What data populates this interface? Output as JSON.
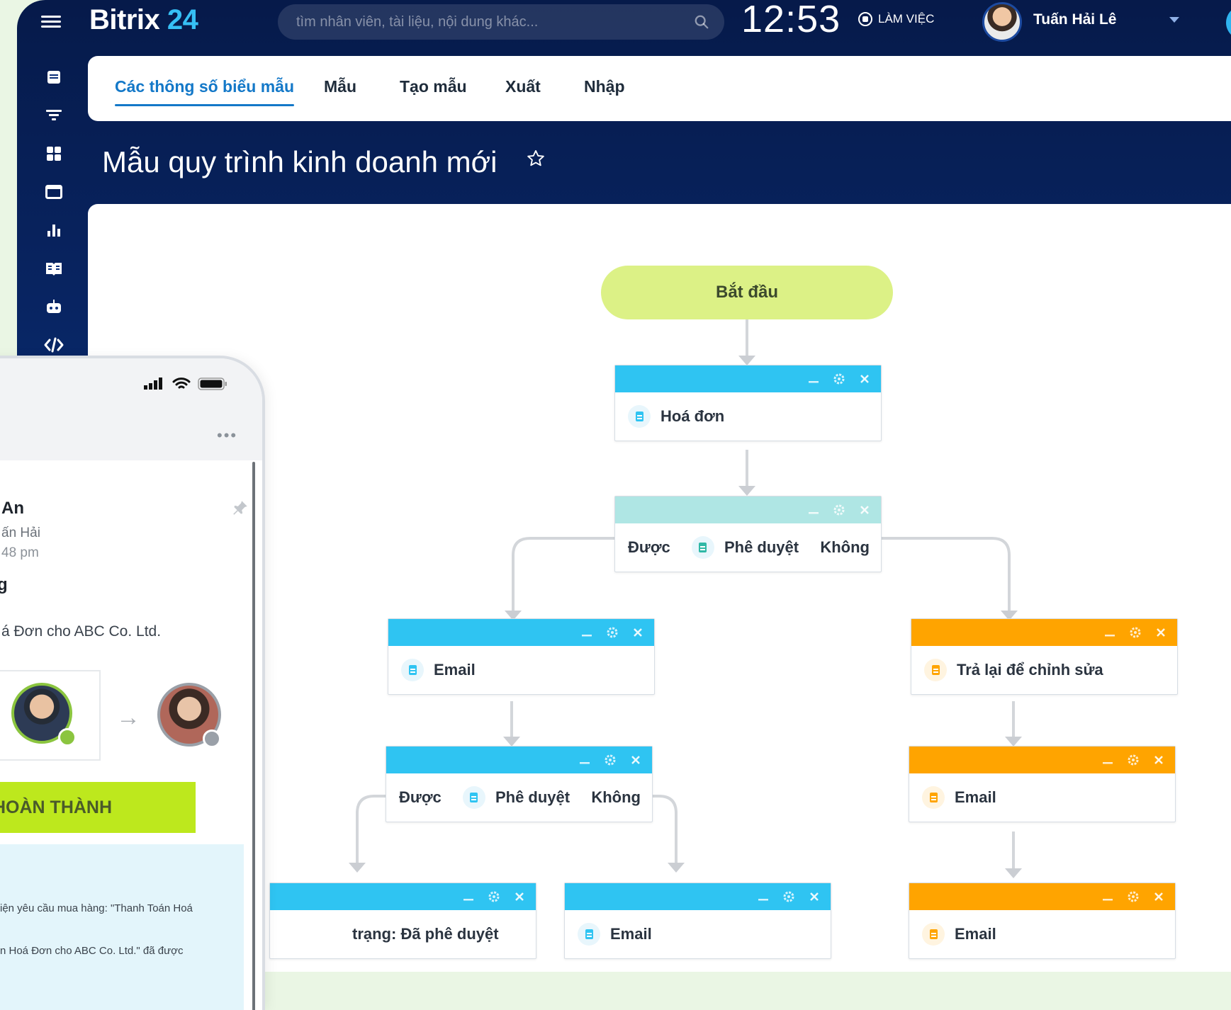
{
  "header": {
    "logo_main": "Bitrix",
    "logo_num": "24",
    "search_placeholder": "tìm nhân viên, tài liệu, nội dung khác...",
    "clock": "12:53",
    "work_status": "LÀM VIỆC",
    "user_name": "Tuấn Hải Lê"
  },
  "sidebar": {
    "icons": [
      "list-icon",
      "filter-icon",
      "grid-icon",
      "window-icon",
      "chart-icon",
      "book-icon",
      "robot-icon",
      "code-icon"
    ]
  },
  "tabs": [
    {
      "label": "Các thông số biểu mẫu",
      "active": true
    },
    {
      "label": "Mẫu",
      "active": false
    },
    {
      "label": "Tạo mẫu",
      "active": false
    },
    {
      "label": "Xuất",
      "active": false
    },
    {
      "label": "Nhập",
      "active": false
    }
  ],
  "page_title": "Mẫu quy trình kinh doanh mới",
  "workflow": {
    "start": "Bắt đầu",
    "invoice": "Hoá đơn",
    "approve1": {
      "yes": "Được",
      "label": "Phê duyệt",
      "no": "Không"
    },
    "email_left": "Email",
    "approve2": {
      "yes": "Được",
      "label": "Phê duyệt",
      "no": "Không"
    },
    "status_block": "trạng: Đã phê duyệt",
    "email_mid": "Email",
    "return_edit": "Trả lại để chỉnh sửa",
    "email_right1": "Email",
    "email_right2": "Email"
  },
  "mobile": {
    "more": "•••",
    "name": "An",
    "sub": "ấn Hải",
    "time": "48 pm",
    "heading": "g",
    "desc": "á Đơn cho ABC Co. Ltd.",
    "done_button": "HOÀN THÀNH",
    "feed_line1": "iện yêu cầu mua hàng: \"Thanh Toán Hoá",
    "feed_line2": "n Hoá Đơn cho ABC Co. Ltd.\" đã được"
  },
  "colors": {
    "accent": "#1378c8",
    "block_blue": "#2fc4f2",
    "block_cyan": "#afe6e4",
    "block_orange": "#ffa400",
    "start_green": "#dcf186",
    "done_green": "#bde81d"
  }
}
